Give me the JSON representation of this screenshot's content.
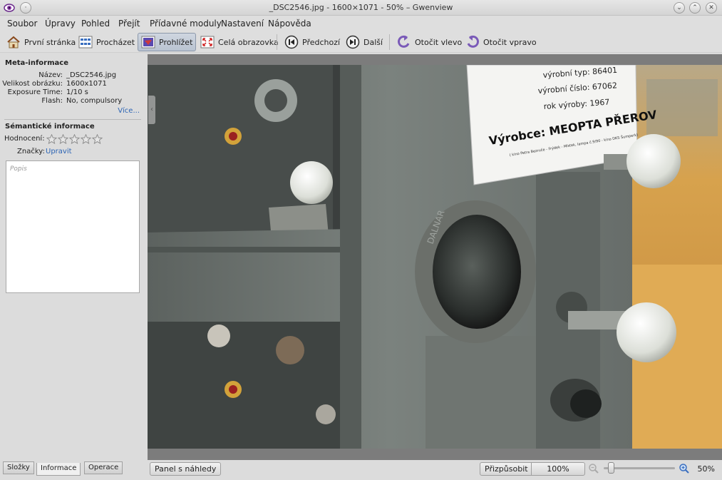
{
  "window": {
    "title": "_DSC2546.jpg - 1600×1071 - 50% – Gwenview"
  },
  "menu": [
    "Soubor",
    "Úpravy",
    "Pohled",
    "Přejít",
    "Přídavné moduly",
    "Nastavení",
    "Nápověda"
  ],
  "toolbar": {
    "first_page": "První stránka",
    "browse": "Procházet",
    "view": "Prohlížet",
    "fullscreen": "Celá obrazovka",
    "previous": "Předchozí",
    "next": "Další",
    "rotate_left": "Otočit vlevo",
    "rotate_right": "Otočit vpravo"
  },
  "sidebar": {
    "meta_title": "Meta-informace",
    "meta": [
      {
        "key": "Název:",
        "value": "_DSC2546.jpg"
      },
      {
        "key": "Velikost obrázku:",
        "value": "1600x1071"
      },
      {
        "key": "Exposure Time:",
        "value": "1/10 s"
      },
      {
        "key": "Flash:",
        "value": "No, compulsory"
      }
    ],
    "more_link": "Více...",
    "semantic_title": "Sémantické informace",
    "rating_label": "Hodnocení:",
    "rating_value": 0,
    "rating_max": 5,
    "tags_label": "Značky:",
    "tags_link": "Upravit",
    "description_placeholder": "Popis"
  },
  "tabs": {
    "folders": "Složky",
    "information": "Informace",
    "operations": "Operace"
  },
  "statusbar": {
    "thumbnail_panel": "Panel s náhledy",
    "fit": "Přizpůsobit",
    "hundred": "100%",
    "zoom_value": "50%",
    "zoom_level": 0.1
  },
  "photo": {
    "sign_lines": [
      "výrobní typ: 86401",
      "výrobní číslo: 67062",
      "rok výroby: 1967"
    ],
    "sign_heading": "Výrobce: MEOPTA PŘEROV",
    "sign_small": "( kino Petra Bezruče - Frýdek - Místek, lampa č.9/90 - kino DKS Šumperk)",
    "lens_text": "DALNAR"
  },
  "colors": {
    "machine_grey": "#6f7571",
    "knob_white": "#e4e6df",
    "background_wood": "#d39a43"
  }
}
